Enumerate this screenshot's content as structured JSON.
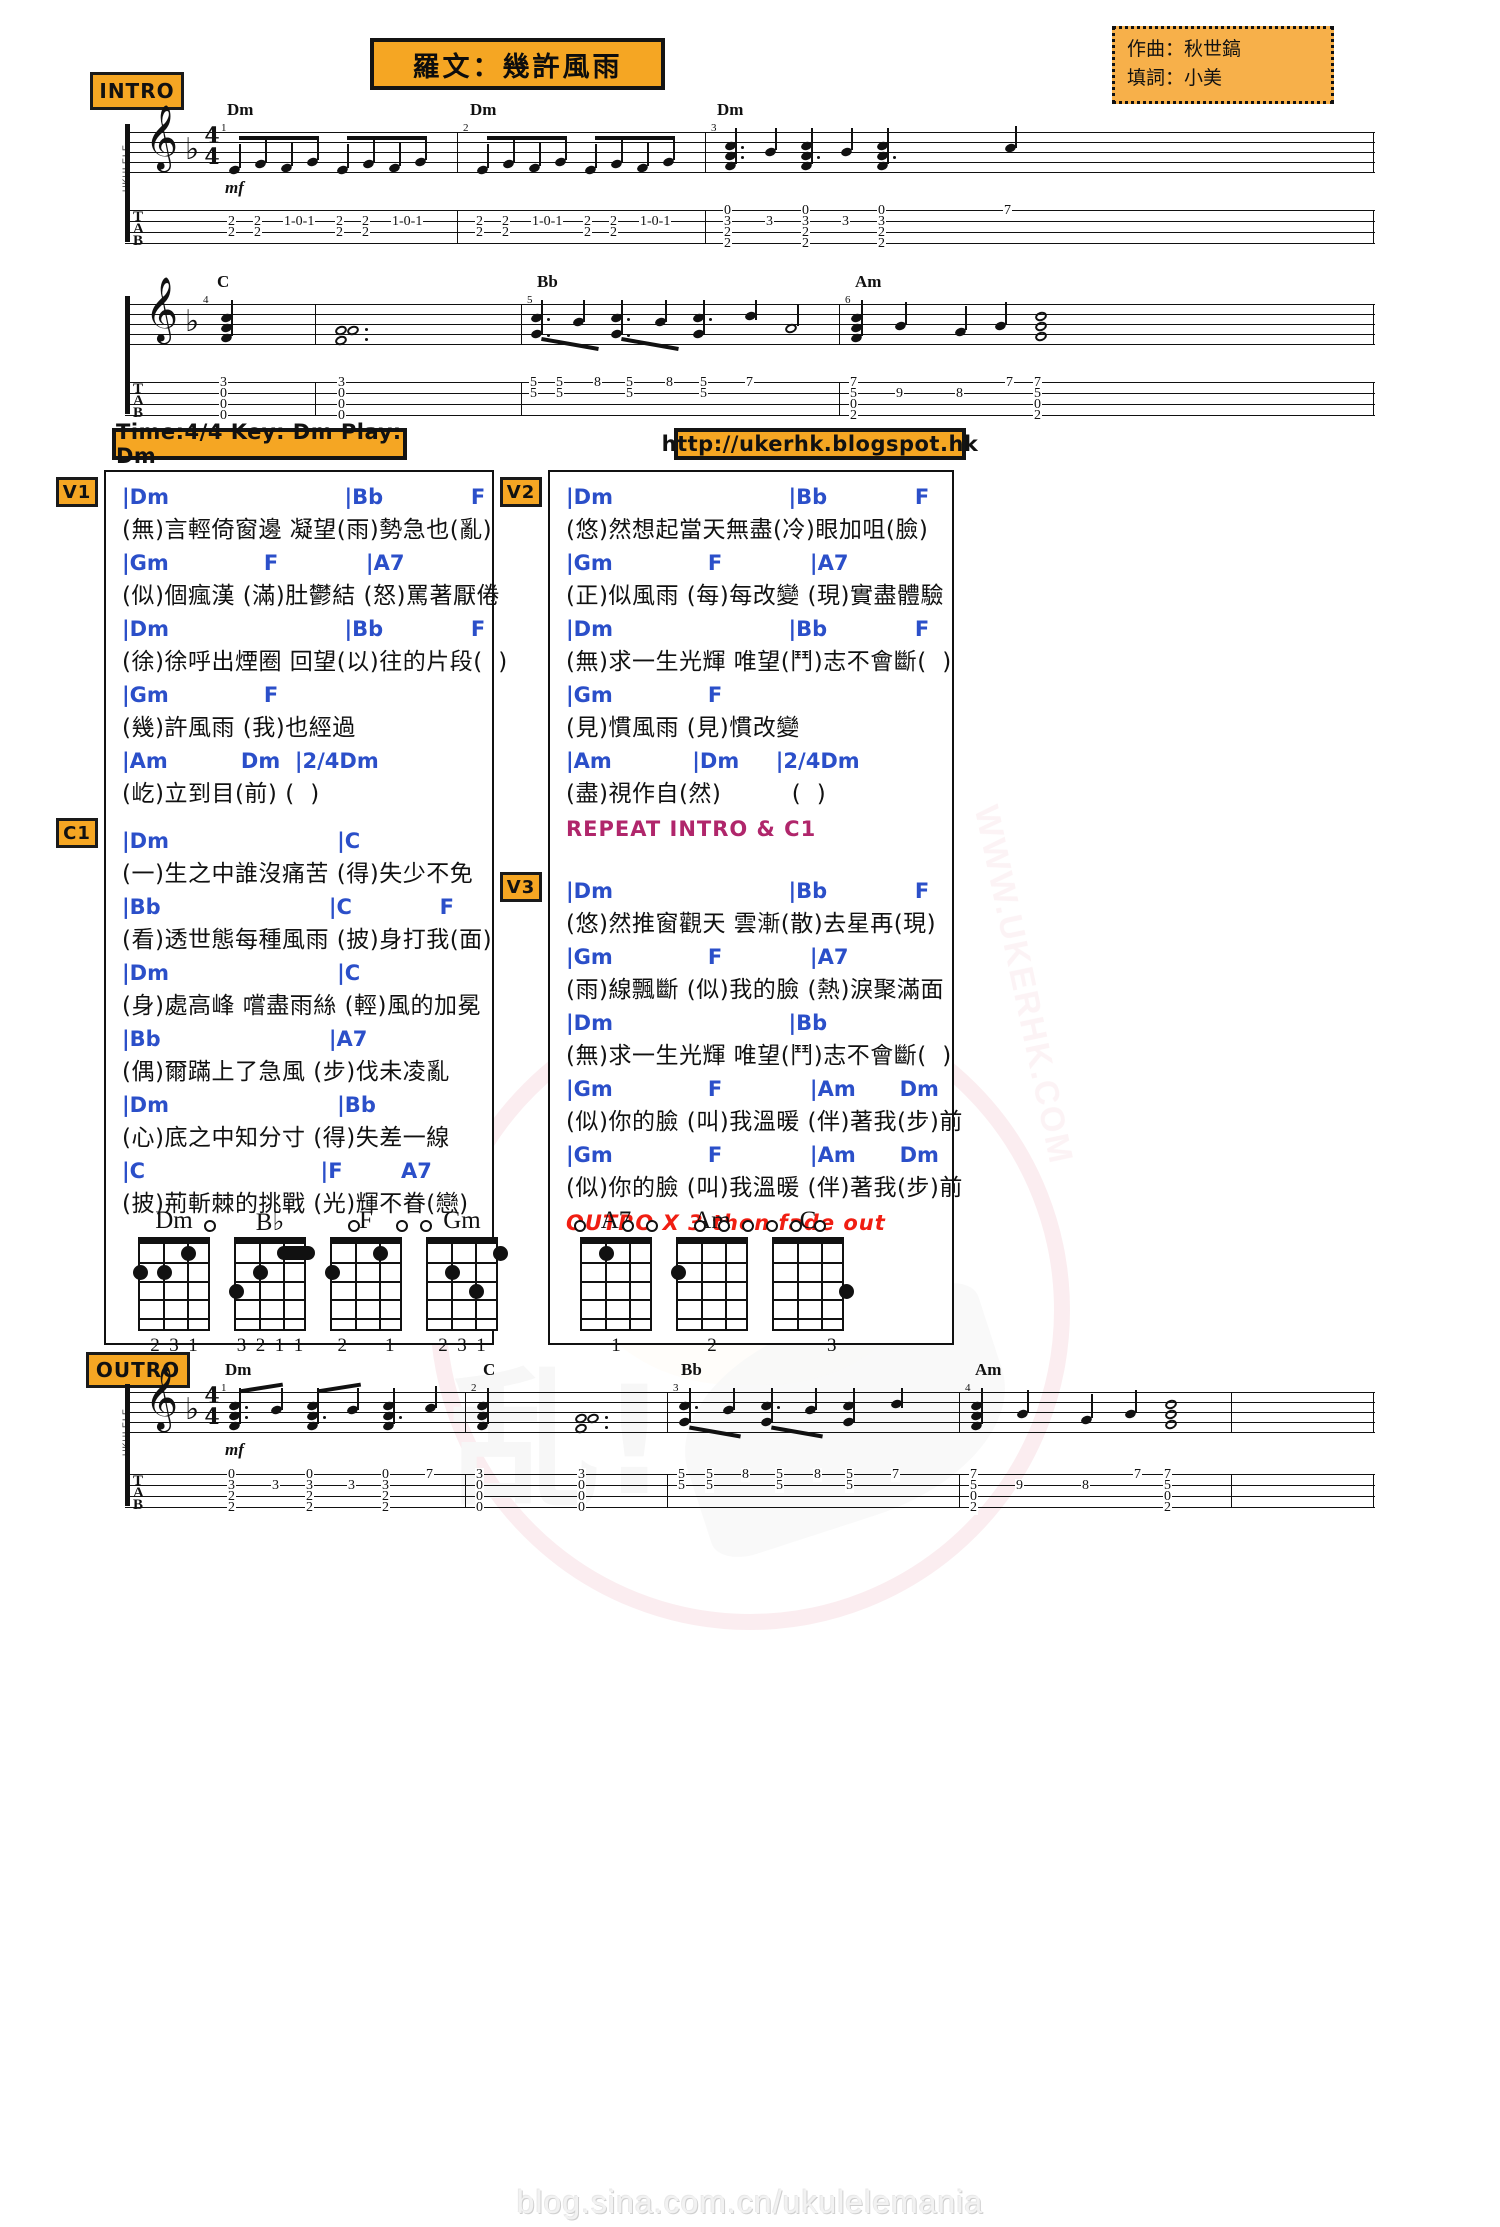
{
  "header": {
    "title": "羅文：幾許風雨",
    "composer_label": "作曲：秋世鎬",
    "lyricist_label": "填詞：小美"
  },
  "banners": {
    "intro": "INTRO",
    "outro": "OUTRO",
    "time_key": "Time:4/4 Key: Dm Play: Dm",
    "url": "http://ukerhk.blogspot.hk"
  },
  "markers": {
    "v1": "V1",
    "v2": "V2",
    "v3": "V3",
    "c1": "C1"
  },
  "notation": {
    "clef": "treble-clef",
    "key_accidental": "flat",
    "time_numerator": "4",
    "time_denominator": "4",
    "dynamic": "mf",
    "tab_letters": [
      "T",
      "A",
      "B"
    ],
    "side_label": "UKULELE",
    "intro_system1": {
      "measure_numbers": [
        "1",
        "2",
        "3"
      ],
      "chords": [
        "Dm",
        "Dm",
        "Dm"
      ],
      "tab_rows": [
        "                                                                      0   0       7",
        "  2 2  1-0-1   2 2  1-0-1 | 2 2  1-0-1   2 2  1-0-1 |  3  3  3  3",
        "  2      2       2      2 |  2      2      2      2 |  2  2  2  2",
        "                          |                          |  0  0  0  0"
      ]
    },
    "intro_system2": {
      "measure_numbers": [
        "4",
        "5",
        "6"
      ],
      "chords": [
        "C",
        "Bb",
        "Am"
      ],
      "tab_rows": [
        "  3        3        5 5  8  5  8  5  7     7   7   7",
        "  0        0        5 5  8  5  8  5  5     9 9 8   5",
        "  0        0        3 3        3        3  0      0",
        "  0        0                               2      2"
      ]
    },
    "outro_system": {
      "measure_numbers": [
        "1",
        "2",
        "3",
        "4"
      ],
      "chords": [
        "Dm",
        "C",
        "Bb",
        "Am"
      ],
      "tab_rows": [
        "  0  0  0  7        3        5  8  5  8  5  7    7   7",
        "  3  3  3           0        5  5  5  5  5  5    9 8 5",
        "  2  2  2           0        3        3       3  0   0",
        "  2  2  2           0                            2   2"
      ]
    }
  },
  "sections": {
    "v1": [
      {
        "type": "chord",
        "text": "|Dm                        |Bb            F"
      },
      {
        "type": "lyric",
        "text": "(無)言輕倚窗邊 凝望(雨)勢急也(亂)"
      },
      {
        "type": "chord",
        "text": "|Gm             F            |A7"
      },
      {
        "type": "lyric",
        "text": "(似)個瘋漢 (滿)肚鬱結 (怒)罵著厭倦"
      },
      {
        "type": "chord",
        "text": "|Dm                        |Bb            F"
      },
      {
        "type": "lyric",
        "text": "(徐)徐呼出煙圈 回望(以)往的片段(  )"
      },
      {
        "type": "chord",
        "text": "|Gm             F"
      },
      {
        "type": "lyric",
        "text": "(幾)許風雨 (我)也經過"
      },
      {
        "type": "chord",
        "text": "|Am          Dm  |2/4Dm"
      },
      {
        "type": "lyric",
        "text": "(屹)立到目(前) (  )"
      }
    ],
    "c1": [
      {
        "type": "chord",
        "text": "|Dm                       |C"
      },
      {
        "type": "lyric",
        "text": "(一)生之中誰沒痛苦 (得)失少不免"
      },
      {
        "type": "chord",
        "text": "|Bb                       |C            F"
      },
      {
        "type": "lyric",
        "text": "(看)透世態每種風雨 (披)身打我(面)"
      },
      {
        "type": "chord",
        "text": "|Dm                       |C"
      },
      {
        "type": "lyric",
        "text": "(身)處高峰 嚐盡雨絲 (輕)風的加冕"
      },
      {
        "type": "chord",
        "text": "|Bb                       |A7"
      },
      {
        "type": "lyric",
        "text": "(偶)爾蹣上了急風 (步)伐未凌亂"
      },
      {
        "type": "chord",
        "text": "|Dm                       |Bb"
      },
      {
        "type": "lyric",
        "text": "(心)底之中知分寸 (得)失差一線"
      },
      {
        "type": "chord",
        "text": "|C                        |F        A7"
      },
      {
        "type": "lyric",
        "text": "(披)荊斬棘的挑戰 (光)輝不眷(戀)"
      }
    ],
    "v2": [
      {
        "type": "chord",
        "text": "|Dm                        |Bb            F"
      },
      {
        "type": "lyric",
        "text": "(悠)然想起當天無盡(冷)眼加咀(臉)"
      },
      {
        "type": "chord",
        "text": "|Gm             F            |A7"
      },
      {
        "type": "lyric",
        "text": "(正)似風雨 (每)每改變 (現)實盡體驗"
      },
      {
        "type": "chord",
        "text": "|Dm                        |Bb            F"
      },
      {
        "type": "lyric",
        "text": "(無)求一生光輝 唯望(鬥)志不會斷(  )"
      },
      {
        "type": "chord",
        "text": "|Gm             F"
      },
      {
        "type": "lyric",
        "text": "(見)慣風雨 (見)慣改變"
      },
      {
        "type": "chord",
        "text": "|Am           |Dm     |2/4Dm"
      },
      {
        "type": "lyric",
        "text": "(盡)視作自(然)         (  )"
      },
      {
        "type": "note-purple",
        "text": "REPEAT INTRO & C1"
      }
    ],
    "v3": [
      {
        "type": "chord",
        "text": "|Dm                        |Bb            F"
      },
      {
        "type": "lyric",
        "text": "(悠)然推窗觀天 雲漸(散)去星再(現)"
      },
      {
        "type": "chord",
        "text": "|Gm             F            |A7"
      },
      {
        "type": "lyric",
        "text": "(雨)線飄斷 (似)我的臉 (熱)淚聚滿面"
      },
      {
        "type": "chord",
        "text": "|Dm                        |Bb"
      },
      {
        "type": "lyric",
        "text": "(無)求一生光輝 唯望(鬥)志不會斷(  )"
      },
      {
        "type": "chord",
        "text": "|Gm             F            |Am      Dm"
      },
      {
        "type": "lyric",
        "text": "(似)你的臉 (叫)我溫暖 (伴)著我(步)前"
      },
      {
        "type": "chord",
        "text": "|Gm             F            |Am      Dm"
      },
      {
        "type": "lyric",
        "text": "(似)你的臉 (叫)我溫暖 (伴)著我(步)前"
      },
      {
        "type": "note-red",
        "text": "OUTRO X 3 then fade out"
      }
    ]
  },
  "chord_diagrams_left": [
    {
      "name": "Dm",
      "fingering": "2  3  1"
    },
    {
      "name": "B♭",
      "fingering": "3  2  1  1"
    },
    {
      "name": "F",
      "fingering": "2        1"
    },
    {
      "name": "Gm",
      "fingering": "2  3  1"
    }
  ],
  "chord_diagrams_right": [
    {
      "name": "A7",
      "fingering": "1"
    },
    {
      "name": "Am",
      "fingering": "2"
    },
    {
      "name": "C",
      "fingering": "          3"
    }
  ],
  "footer": {
    "watermark": "blog.sina.com.cn/ukulelemania"
  },
  "colors": {
    "accent_orange": "#f5a623",
    "chord_blue": "#2b4fc9",
    "note_purple": "#b0266b",
    "note_red": "#f01e12",
    "ink": "#111111"
  }
}
